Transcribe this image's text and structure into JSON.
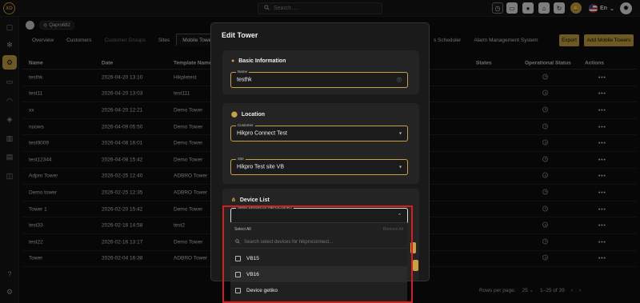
{
  "topbar": {
    "search_placeholder": "Search ...",
    "icons": [
      "clock-icon",
      "monitor-icon",
      "user-icon",
      "home-icon",
      "refresh-icon",
      "bell-icon"
    ],
    "language": "En",
    "notification_badge": "0"
  },
  "org": {
    "name": "Qapro682"
  },
  "tabs": [
    "Overview",
    "Customers",
    "Customer Groups",
    "Sites",
    "Mobile Towers"
  ],
  "tabs_right": [
    "s Scheduler",
    "Alarm Management System"
  ],
  "buttons": {
    "export": "Export",
    "add_tower": "Add Mobile Towers"
  },
  "table": {
    "columns": [
      "Name",
      "Date",
      "Template Name",
      "States",
      "Operational Status",
      "Actions"
    ],
    "rows": [
      {
        "name": "testhk",
        "date": "2026-04-20 13:10",
        "template": "Hikpletest"
      },
      {
        "name": "test11",
        "date": "2026-04-20 13:03",
        "template": "test111"
      },
      {
        "name": "xx",
        "date": "2026-04-20 12:21",
        "template": "Demo Tower"
      },
      {
        "name": "nuows",
        "date": "2026-04-09 05:50",
        "template": "Demo Tower"
      },
      {
        "name": "test9009",
        "date": "2026-04-08 16:01",
        "template": "Demo Tower"
      },
      {
        "name": "test12344",
        "date": "2026-04-08 15:42",
        "template": "Demo Tower"
      },
      {
        "name": "Adpro Tower",
        "date": "2026-02-25 12:40",
        "template": "ADBRO Tower"
      },
      {
        "name": "Demo tower",
        "date": "2026-02-25 12:35",
        "template": "ADBRO Tower"
      },
      {
        "name": "Tower 1",
        "date": "2026-02-20 15:42",
        "template": "Demo Tower"
      },
      {
        "name": "test33",
        "date": "2026-02-16 14:58",
        "template": "test2"
      },
      {
        "name": "test22",
        "date": "2026-02-16 13:17",
        "template": "Demo Tower"
      },
      {
        "name": "Tower",
        "date": "2026-02-04 16:38",
        "template": "ADBRO Tower"
      }
    ],
    "actions_label": "•••"
  },
  "pager": {
    "rows_per_page_label": "Rows per page:",
    "rows_per_page": "25",
    "range": "1–25 of 39"
  },
  "modal": {
    "title": "Edit Tower",
    "basic": {
      "heading": "Basic Information",
      "name_label": "Name",
      "name_value": "testhk"
    },
    "location": {
      "heading": "Location",
      "customer_label": "Customer",
      "customer_value": "Hikpro Connect Test",
      "site_label": "Site",
      "site_value": "Hikpro Test site VB"
    },
    "devices": {
      "heading": "Device List",
      "select_label": "Select Devices for HikProConnect",
      "select_all": "Select All",
      "remove_all": "Remove All",
      "search_placeholder": "Search select devices for hikproconnect...",
      "options": [
        "VB15",
        "VB16",
        "Device getiko"
      ]
    }
  },
  "colors": {
    "accent": "#c9a042",
    "highlight": "#d21f1f"
  }
}
